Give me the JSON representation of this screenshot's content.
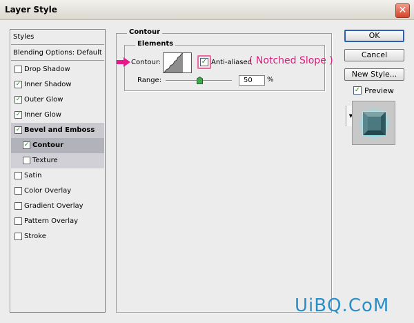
{
  "window": {
    "title": "Layer Style",
    "close_glyph": "✕"
  },
  "style_list": {
    "header_styles": "Styles",
    "header_blending": "Blending Options: Default",
    "items": [
      {
        "label": "Drop Shadow",
        "checked": false
      },
      {
        "label": "Inner Shadow",
        "checked": true
      },
      {
        "label": "Outer Glow",
        "checked": true
      },
      {
        "label": "Inner Glow",
        "checked": true
      },
      {
        "label": "Bevel and Emboss",
        "checked": true
      },
      {
        "label": "Contour",
        "checked": true
      },
      {
        "label": "Texture",
        "checked": false
      },
      {
        "label": "Satin",
        "checked": false
      },
      {
        "label": "Color Overlay",
        "checked": false
      },
      {
        "label": "Gradient Overlay",
        "checked": false
      },
      {
        "label": "Pattern Overlay",
        "checked": false
      },
      {
        "label": "Stroke",
        "checked": false
      }
    ],
    "check_glyph": "✓"
  },
  "contour_panel": {
    "group_title": "Contour",
    "elements_title": "Elements",
    "contour_label": "Contour:",
    "anti_aliased_label": "Anti-aliased",
    "anti_aliased_checked": true,
    "annotation": "( Notched Slope )",
    "range_label": "Range:",
    "range_value": "50",
    "range_unit": "%",
    "range_level_percent": 50,
    "dropdown_glyph": "▼"
  },
  "buttons": {
    "ok": "OK",
    "cancel": "Cancel",
    "new_style": "New Style..."
  },
  "preview": {
    "label": "Preview",
    "checked": true
  },
  "watermark": "UiBQ.CoM",
  "colors": {
    "annotation": "#e0177d",
    "watermark": "#2a8ec9",
    "selection": "#b2b2ba"
  }
}
